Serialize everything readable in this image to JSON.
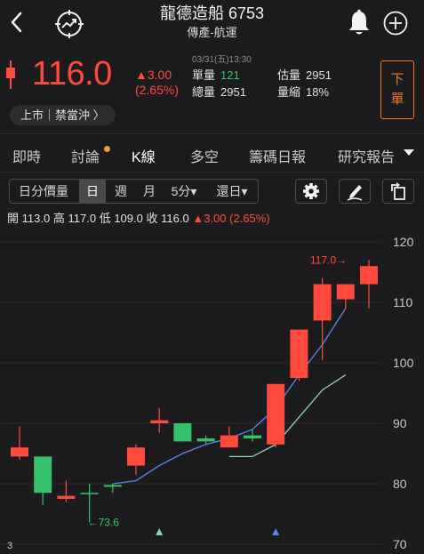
{
  "header": {
    "title": "龍德造船 6753",
    "subtitle": "傳產-航運"
  },
  "quote": {
    "price": "116.0",
    "change": "▲3.00",
    "change_pct": "(2.65%)",
    "datetime": "03/31(五)13:30",
    "single_volume_label": "單量",
    "single_volume": "121",
    "total_volume_label": "總量",
    "total_volume": "2951",
    "est_volume_label": "估量",
    "est_volume": "2951",
    "volume_ratio_label": "量縮",
    "volume_ratio": "18%",
    "status": "上市｜禁當沖 〉",
    "sell_label_1": "下",
    "sell_label_2": "單",
    "up_color": "#ff4a3d",
    "down_color": "#36c26b"
  },
  "tabs": [
    "即時",
    "討論",
    "K線",
    "多空",
    "籌碼日報",
    "研究報告"
  ],
  "toolbar": {
    "daily_volume": "日分價量",
    "day": "日",
    "week": "週",
    "month": "月",
    "five_min": "5分▾",
    "period": "還日▾"
  },
  "ohlc": {
    "open_label": "開",
    "open": "113.0",
    "high_label": "高",
    "high": "117.0",
    "low_label": "低",
    "low": "109.0",
    "close_label": "收",
    "close": "116.0",
    "change": "▲3.00 (2.65%)"
  },
  "chart_data": {
    "type": "candlestick",
    "y_ticks": [
      120,
      110,
      100,
      90,
      80,
      70
    ],
    "ylim": [
      70,
      120
    ],
    "max_label": "117.0→",
    "min_label": "←73.6",
    "left_edge_label": "3",
    "candles": [
      {
        "o": 84.5,
        "c": 86.0,
        "h": 89.5,
        "l": 84.0,
        "color": "red"
      },
      {
        "o": 84.5,
        "c": 78.5,
        "h": 84.5,
        "l": 76.5,
        "color": "green"
      },
      {
        "o": 78.0,
        "c": 77.5,
        "h": 80.5,
        "l": 77.0,
        "color": "red"
      },
      {
        "o": 78.5,
        "c": 78.5,
        "h": 80.0,
        "l": 73.6,
        "color": "green"
      },
      {
        "o": 79.5,
        "c": 79.8,
        "h": 80.0,
        "l": 78.5,
        "color": "green"
      },
      {
        "o": 83.0,
        "c": 86.0,
        "h": 86.5,
        "l": 81.5,
        "color": "red"
      },
      {
        "o": 90.0,
        "c": 90.5,
        "h": 92.5,
        "l": 88.5,
        "color": "red"
      },
      {
        "o": 90.0,
        "c": 87.0,
        "h": 90.0,
        "l": 87.0,
        "color": "green"
      },
      {
        "o": 87.5,
        "c": 87.0,
        "h": 88.0,
        "l": 86.5,
        "color": "green"
      },
      {
        "o": 86.0,
        "c": 88.0,
        "h": 89.5,
        "l": 86.0,
        "color": "red"
      },
      {
        "o": 88.0,
        "c": 87.5,
        "h": 89.0,
        "l": 87.0,
        "color": "green"
      },
      {
        "o": 86.5,
        "c": 96.5,
        "h": 96.5,
        "l": 86.0,
        "color": "red"
      },
      {
        "o": 97.5,
        "c": 105.5,
        "h": 105.5,
        "l": 97.0,
        "color": "red"
      },
      {
        "o": 107.0,
        "c": 113.0,
        "h": 114.0,
        "l": 100.5,
        "color": "red"
      },
      {
        "o": 110.5,
        "c": 113.0,
        "h": 113.0,
        "l": 109.0,
        "color": "red"
      },
      {
        "o": 113.0,
        "c": 116.0,
        "h": 117.0,
        "l": 109.0,
        "color": "red"
      }
    ],
    "ma_fast": [
      [
        4,
        80.0
      ],
      [
        5,
        80.5
      ],
      [
        6,
        83.0
      ],
      [
        7,
        85.0
      ],
      [
        8,
        86.5
      ],
      [
        9,
        87.5
      ],
      [
        10,
        89.0
      ],
      [
        11,
        92.5
      ],
      [
        12,
        98.0
      ],
      [
        13,
        103.0
      ],
      [
        14,
        109.0
      ]
    ],
    "ma_slow": [
      [
        9,
        84.5
      ],
      [
        10,
        84.5
      ],
      [
        11,
        86.5
      ],
      [
        12,
        91.0
      ],
      [
        13,
        95.5
      ],
      [
        14,
        98.0
      ]
    ],
    "markers": [
      [
        6,
        "green"
      ],
      [
        11,
        "blue"
      ]
    ]
  }
}
